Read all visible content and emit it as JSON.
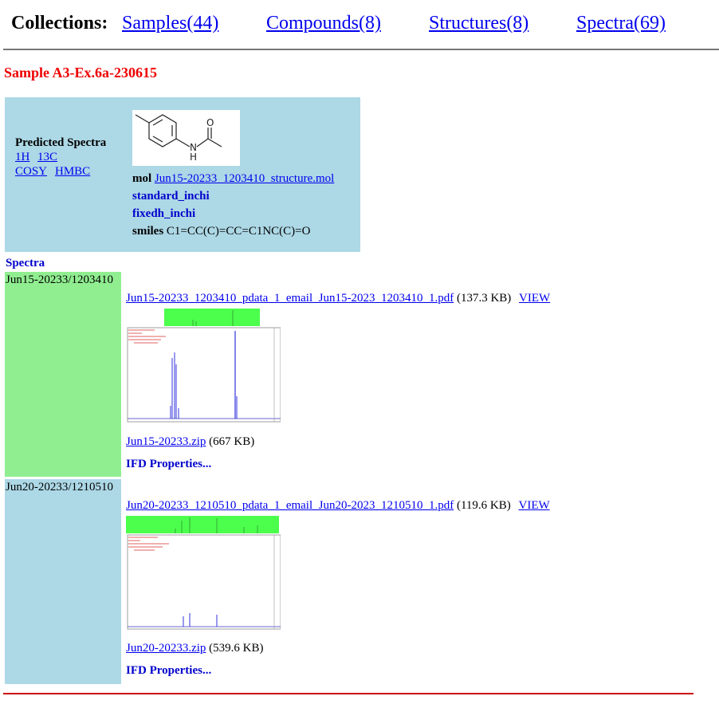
{
  "nav": {
    "title": "Collections:",
    "links": [
      "Samples(44)",
      "Compounds(8)",
      "Structures(8)",
      "Spectra(69)"
    ]
  },
  "sample": {
    "title": "Sample A3-Ex.6a-230615"
  },
  "info": {
    "predicted_title": "Predicted Spectra",
    "predicted_links": [
      "1H",
      "13C",
      "COSY",
      "HMBC"
    ],
    "mol_key": "mol",
    "mol_file": "Jun15-20233_1203410_structure.mol",
    "standard_inchi": "standard_inchi",
    "fixedh_inchi": "fixedh_inchi",
    "smiles_key": "smiles",
    "smiles_value": "C1=CC(C)=CC=C1NC(C)=O",
    "structure_labels": {
      "o": "O",
      "n": "N",
      "h": "H"
    }
  },
  "spectra": {
    "heading": "Spectra",
    "rows": [
      {
        "label": "Jun15-20233/1203410",
        "pdf": "Jun15-20233_1203410_pdata_1_email_Jun15-2023_1203410_1.pdf",
        "pdf_size": "(137.3 KB)",
        "view": "VIEW",
        "zip": "Jun15-20233.zip",
        "zip_size": "(667 KB)",
        "ifd": "IFD Properties..."
      },
      {
        "label": "Jun20-20233/1210510",
        "pdf": "Jun20-20233_1210510_pdata_1_email_Jun20-2023_1210510_1.pdf",
        "pdf_size": "(119.6 KB)",
        "view": "VIEW",
        "zip": "Jun20-20233.zip",
        "zip_size": "(539.6 KB)",
        "ifd": "IFD Properties..."
      }
    ]
  },
  "colors": {
    "sample_title": "#ee0000",
    "info_bg": "#add8e6",
    "row1_bg": "#90ee90",
    "row2_bg": "#add8e6",
    "bottom_rule": "#cc0000"
  }
}
